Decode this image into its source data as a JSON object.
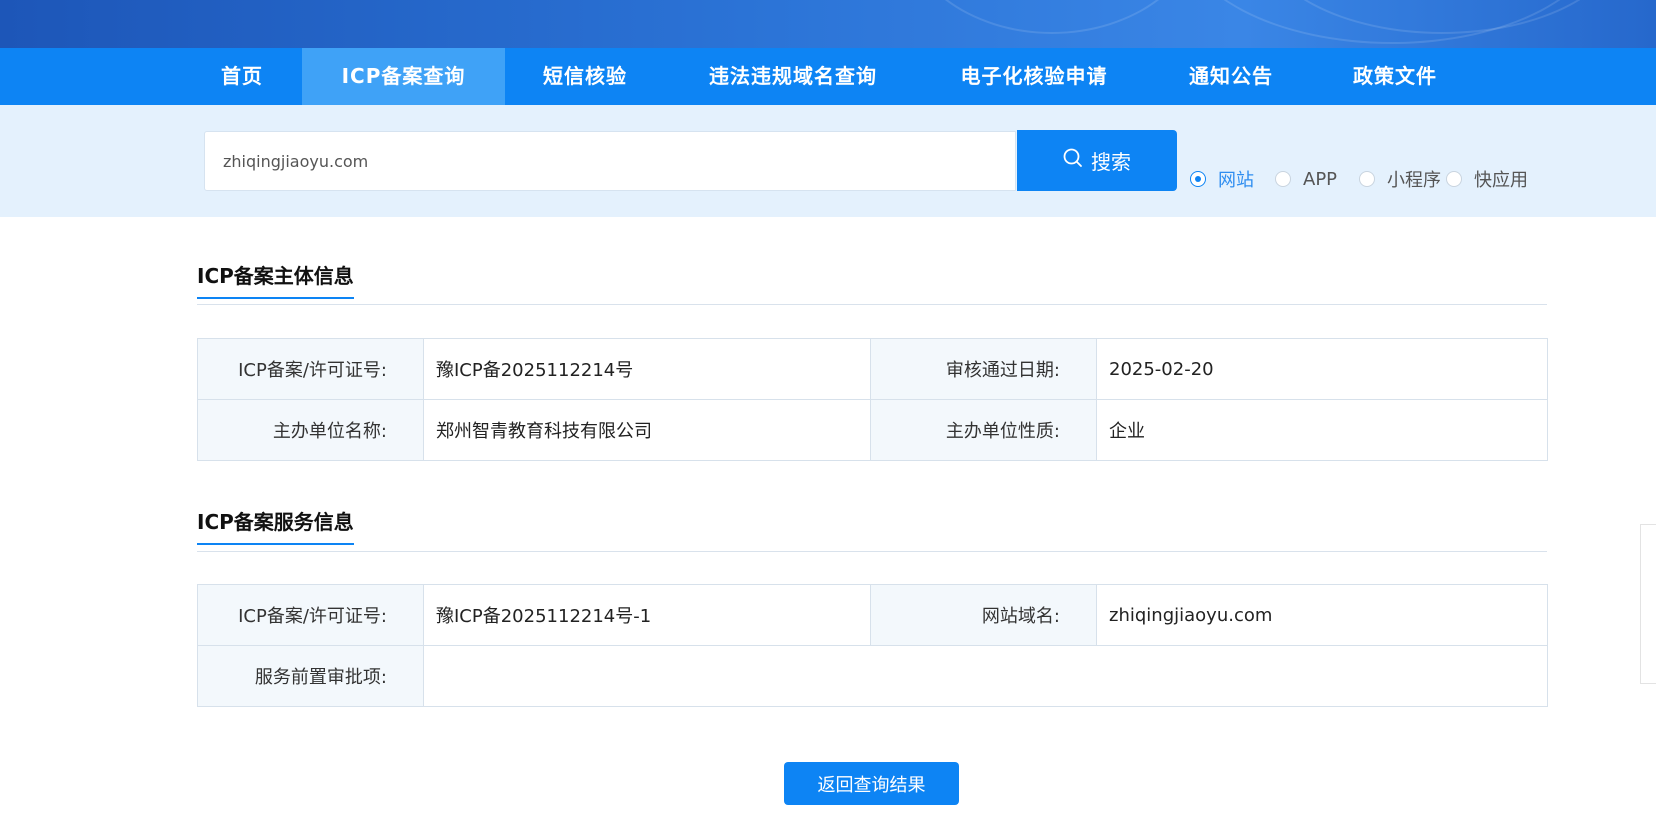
{
  "nav": {
    "items": [
      "首页",
      "ICP备案查询",
      "短信核验",
      "违法违规域名查询",
      "电子化核验申请",
      "通知公告",
      "政策文件"
    ],
    "active_index": 1
  },
  "search": {
    "value": "zhiqingjiaoyu.com",
    "button_label": "搜索",
    "types": [
      "网站",
      "APP",
      "小程序",
      "快应用"
    ],
    "selected_type": "网站"
  },
  "subject_section": {
    "title": "ICP备案主体信息",
    "rows": [
      [
        {
          "label": "ICP备案/许可证号:",
          "value": "豫ICP备2025112214号"
        },
        {
          "label": "审核通过日期:",
          "value": "2025-02-20"
        }
      ],
      [
        {
          "label": "主办单位名称:",
          "value": "郑州智青教育科技有限公司"
        },
        {
          "label": "主办单位性质:",
          "value": "企业"
        }
      ]
    ]
  },
  "service_section": {
    "title": "ICP备案服务信息",
    "license_label": "ICP备案/许可证号:",
    "license_value": "豫ICP备2025112214号-1",
    "domain_label": "网站域名:",
    "domain_value": "zhiqingjiaoyu.com",
    "preapproval_label": "服务前置审批项:",
    "preapproval_value": ""
  },
  "back_button_label": "返回查询结果",
  "colors": {
    "primary": "#0d84f4",
    "nav_active": "#3fa2f7",
    "search_band": "#e4f1fd",
    "label_cell_bg": "#f3f8fc"
  }
}
